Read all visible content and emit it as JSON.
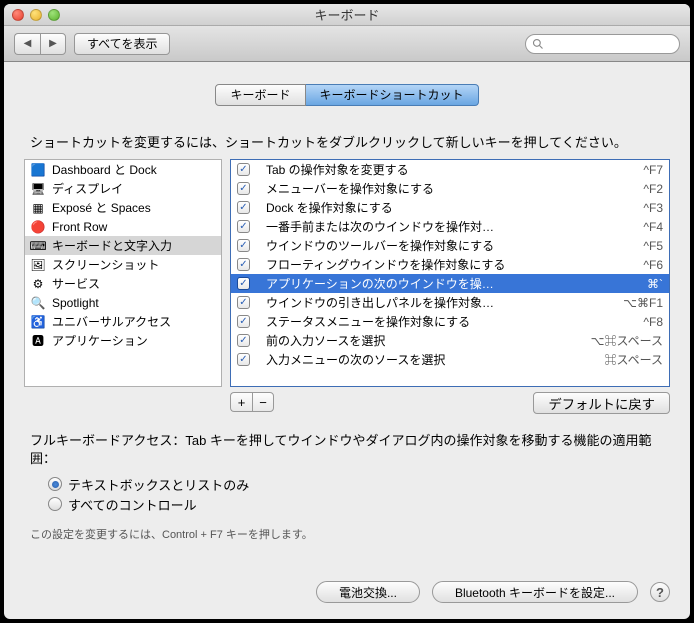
{
  "window": {
    "title": "キーボード"
  },
  "toolbar": {
    "show_all": "すべてを表示"
  },
  "tabs": {
    "keyboard": "キーボード",
    "shortcuts": "キーボードショートカット"
  },
  "instruction": "ショートカットを変更するには、ショートカットをダブルクリックして新しいキーを押してください。",
  "categories": [
    {
      "label": "Dashboard と Dock",
      "icon": "🟦"
    },
    {
      "label": "ディスプレイ",
      "icon": "🖥"
    },
    {
      "label": "Exposé と Spaces",
      "icon": "▦"
    },
    {
      "label": "Front Row",
      "icon": "🔴"
    },
    {
      "label": "キーボードと文字入力",
      "icon": "⌨",
      "selected": true
    },
    {
      "label": "スクリーンショット",
      "icon": "🖼"
    },
    {
      "label": "サービス",
      "icon": "⚙"
    },
    {
      "label": "Spotlight",
      "icon": "🔍"
    },
    {
      "label": "ユニバーサルアクセス",
      "icon": "♿"
    },
    {
      "label": "アプリケーション",
      "icon": "🅰"
    }
  ],
  "shortcuts": [
    {
      "label": "Tab の操作対象を変更する",
      "key": "^F7"
    },
    {
      "label": "メニューバーを操作対象にする",
      "key": "^F2"
    },
    {
      "label": "Dock を操作対象にする",
      "key": "^F3"
    },
    {
      "label": "一番手前または次のウインドウを操作対…",
      "key": "^F4"
    },
    {
      "label": "ウインドウのツールバーを操作対象にする",
      "key": "^F5"
    },
    {
      "label": "フローティングウインドウを操作対象にする",
      "key": "^F6"
    },
    {
      "label": "アプリケーションの次のウインドウを操…",
      "key": "⌘`",
      "selected": true
    },
    {
      "label": "ウインドウの引き出しパネルを操作対象…",
      "key": "⌥⌘F1"
    },
    {
      "label": "ステータスメニューを操作対象にする",
      "key": "^F8"
    },
    {
      "label": "前の入力ソースを選択",
      "key": "⌥⌘スペース"
    },
    {
      "label": "入力メニューの次のソースを選択",
      "key": "⌘スペース"
    }
  ],
  "buttons": {
    "defaults": "デフォルトに戻す",
    "battery": "電池交換...",
    "bluetooth": "Bluetooth キーボードを設定..."
  },
  "fka": {
    "desc": "フルキーボードアクセス：Tab キーを押してウインドウやダイアログ内の操作対象を移動する機能の適用範囲：",
    "opt1": "テキストボックスとリストのみ",
    "opt2": "すべてのコントロール",
    "hint": "この設定を変更するには、Control + F7 キーを押します。"
  }
}
